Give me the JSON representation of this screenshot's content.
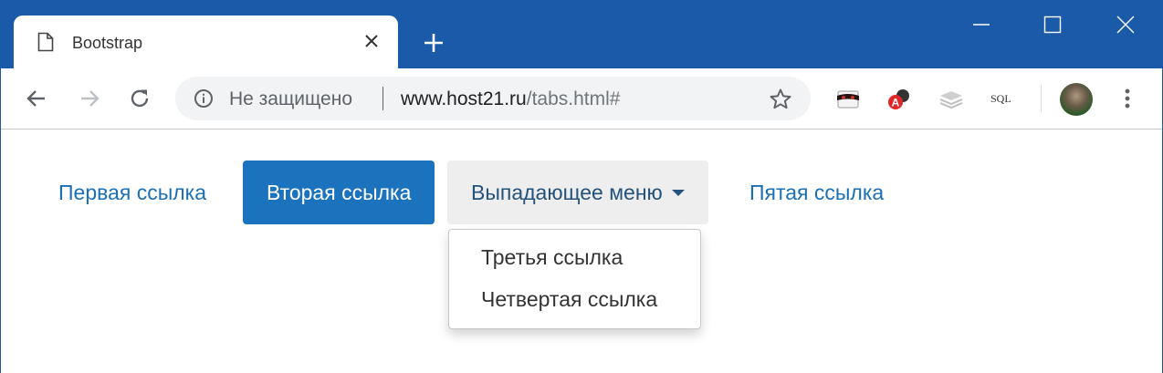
{
  "browser": {
    "tab": {
      "title": "Bootstrap",
      "page_icon": "page-icon",
      "close_icon": "close-icon"
    },
    "new_tab_icon": "plus-icon",
    "window_controls": [
      "minimize-icon",
      "maximize-icon",
      "close-icon"
    ],
    "toolbar": {
      "back_icon": "back-arrow-icon",
      "forward_icon": "forward-arrow-icon",
      "reload_icon": "reload-icon",
      "security_text": "Не защищено",
      "url_host": "www.host21.ru",
      "url_path": "/tabs.html#",
      "bookmark_icon": "star-icon",
      "extensions": [
        "mask-extension-icon",
        "translate-extension-icon",
        "layers-extension-icon",
        "sql-extension"
      ],
      "sql_label": "SQL",
      "menu_icon": "more-vertical-icon"
    }
  },
  "page": {
    "nav": [
      {
        "label": "Первая ссылка",
        "state": "link"
      },
      {
        "label": "Вторая ссылка",
        "state": "active"
      },
      {
        "label": "Выпадающее меню",
        "state": "dropdown-open"
      },
      {
        "label": "Пятая ссылка",
        "state": "link"
      }
    ],
    "dropdown_items": [
      "Третья ссылка",
      "Четвертая ссылка"
    ]
  },
  "colors": {
    "titlebar": "#1a5aa8",
    "link": "#1b6fb5",
    "active_pill": "#1a73bc",
    "dropdown_toggle_bg": "#eeeeee"
  }
}
